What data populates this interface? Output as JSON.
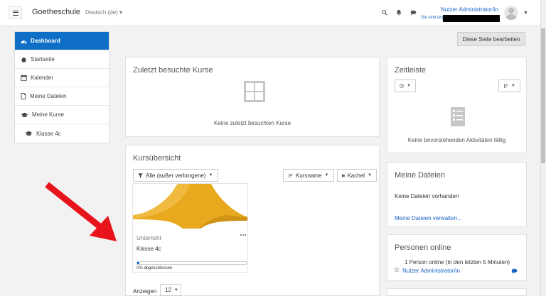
{
  "navbar": {
    "site_name": "Goetheschule",
    "language": "Deutsch (de) ▾",
    "user_name": "Nutzer Administrator/in",
    "user_sub": "Sie sind angem"
  },
  "sidebar": {
    "items": [
      {
        "label": "Dashboard",
        "icon": "dashboard-icon"
      },
      {
        "label": "Startseite",
        "icon": "home-icon"
      },
      {
        "label": "Kalender",
        "icon": "calendar-icon"
      },
      {
        "label": "Meine Dateien",
        "icon": "file-icon"
      },
      {
        "label": "Meine Kurse",
        "icon": "graduation-cap-icon"
      },
      {
        "label": "Klasse 4c",
        "icon": "graduation-cap-icon"
      }
    ]
  },
  "edit_button": "Diese Seite bearbeiten",
  "recent_courses": {
    "title": "Zuletzt besuchte Kurse",
    "empty": "Keine zuletzt besuchten Kurse"
  },
  "timeline": {
    "title": "Zeitleiste",
    "empty": "Keine bevorstehenden Aktivitäten fällig"
  },
  "course_overview": {
    "title": "Kursübersicht",
    "filter": "Alle (außer verborgene)",
    "sort": "Kursname",
    "view": "Kachel",
    "course": {
      "category": "Unterricht",
      "name": "Klasse 4c",
      "progress_text": "0% abgeschlossen",
      "progress": 0.02
    },
    "show_label": "Anzeigen",
    "show_value": "12"
  },
  "my_files": {
    "title": "Meine Dateien",
    "empty": "Keine Dateien vorhanden",
    "manage_link": "Meine Dateien verwalten..."
  },
  "online_users": {
    "title": "Personen online",
    "summary": "1 Person online (in den letzten 5 Minuten)",
    "user": "Nutzer Administrator/in"
  },
  "colors": {
    "accent": "#0f6fc6",
    "link": "#1a64c4",
    "arrow": "#e8141b",
    "tile_image": "#e8a91e"
  }
}
